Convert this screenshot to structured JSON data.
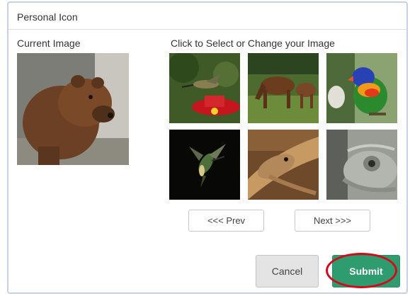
{
  "dialog": {
    "title": "Personal Icon",
    "current_label": "Current Image",
    "select_label": "Click to Select or Change your Image"
  },
  "current_image": {
    "icon": "brown-bear-photo"
  },
  "gallery": [
    {
      "icon": "hummingbird-feeder-photo"
    },
    {
      "icon": "horses-photo"
    },
    {
      "icon": "parrot-photo"
    },
    {
      "icon": "hummingbird-flying-photo"
    },
    {
      "icon": "lizard-photo"
    },
    {
      "icon": "chameleon-photo"
    }
  ],
  "pager": {
    "prev_label": "<<< Prev",
    "next_label": "Next >>>"
  },
  "actions": {
    "cancel_label": "Cancel",
    "submit_label": "Submit"
  },
  "colors": {
    "submit_bg": "#2e9c6f",
    "highlight_ring": "#d40a1c",
    "panel_border": "#c7d1e3"
  }
}
